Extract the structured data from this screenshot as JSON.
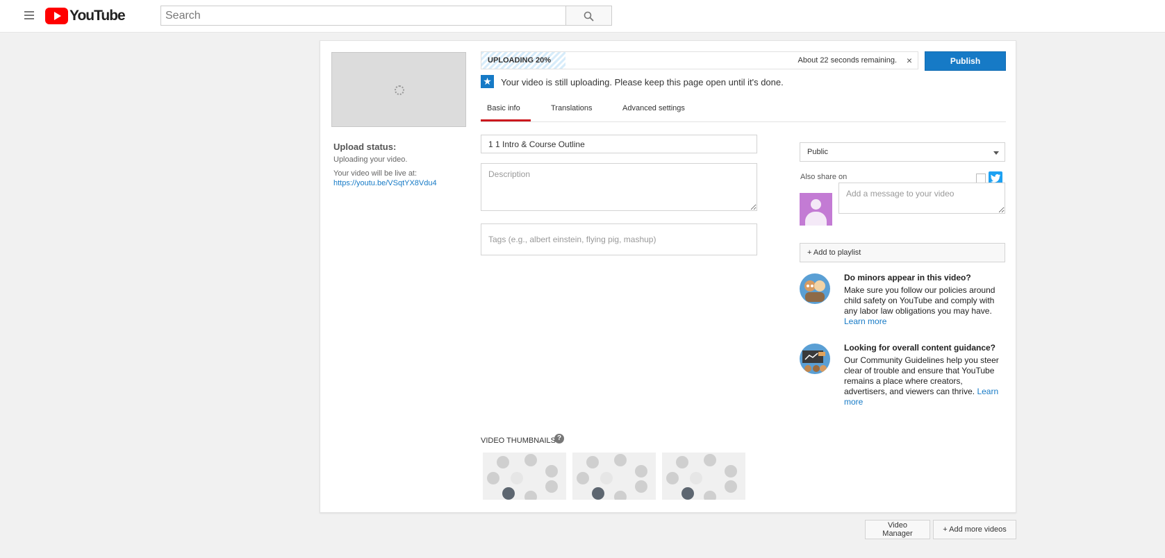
{
  "header": {
    "logo_text": "YouTube",
    "search_placeholder": "Search"
  },
  "left": {
    "status_heading": "Upload status:",
    "status_text": "Uploading your video.",
    "live_text": "Your video will be live at:",
    "live_url": "https://youtu.be/VSqtYX8Vdu4"
  },
  "upload": {
    "progress_label": "UPLOADING 20%",
    "progress_fraction": 0.2,
    "remaining": "About 22 seconds remaining.",
    "close": "×",
    "publish_label": "Publish",
    "notice": "Your video is still uploading. Please keep this page open until it's done."
  },
  "tabs": [
    {
      "label": "Basic info",
      "active": true
    },
    {
      "label": "Translations",
      "active": false
    },
    {
      "label": "Advanced settings",
      "active": false
    }
  ],
  "form": {
    "title_value": "1 1 Intro & Course Outline",
    "description_placeholder": "Description",
    "tags_placeholder": "Tags (e.g., albert einstein, flying pig, mashup)"
  },
  "sidebar": {
    "privacy_value": "Public",
    "share_label": "Also share on",
    "message_placeholder": "Add a message to your video",
    "playlist_label": "+ Add to playlist"
  },
  "guidance": [
    {
      "title": "Do minors appear in this video?",
      "body": "Make sure you follow our policies around child safety on YouTube and comply with any labor law obligations you may have.",
      "link": "Learn more"
    },
    {
      "title": "Looking for overall content guidance?",
      "body": "Our Community Guidelines help you steer clear of trouble and ensure that YouTube remains a place where creators, advertisers, and viewers can thrive.",
      "link": "Learn more"
    }
  ],
  "thumbnails": {
    "label": "VIDEO THUMBNAILS",
    "help": "?"
  },
  "footer": {
    "video_manager": "Video Manager",
    "add_more": "Add more videos"
  },
  "colors": {
    "brand_red": "#ff0000",
    "accent_blue": "#167ac6",
    "tab_underline": "#cc181e"
  }
}
